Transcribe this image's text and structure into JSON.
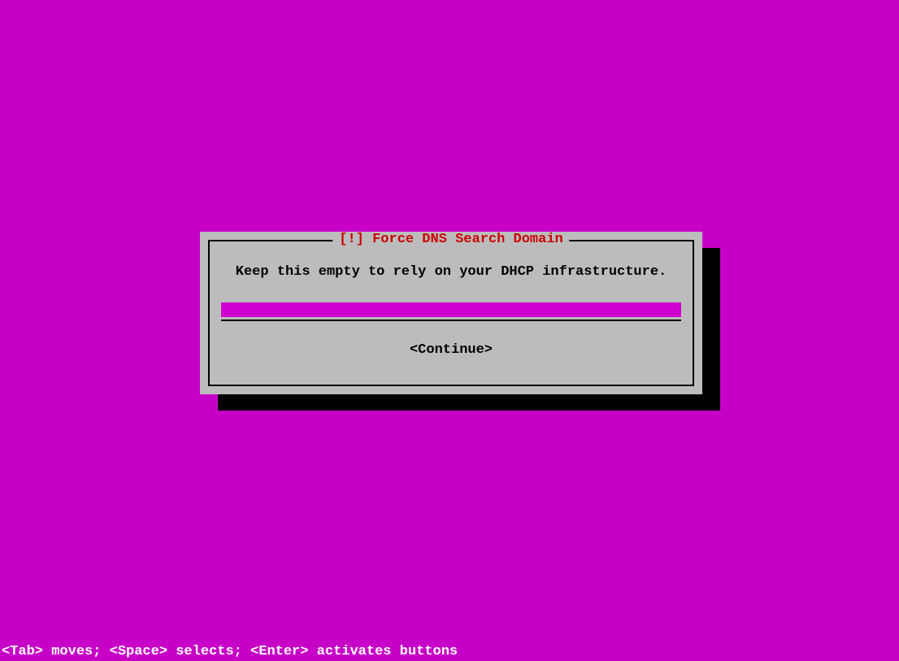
{
  "dialog": {
    "title_prefix": "[!] ",
    "title": "Force DNS Search Domain",
    "instruction": "Keep this empty to rely on your DHCP infrastructure.",
    "input_value": "",
    "continue_label": "<Continue>"
  },
  "footer": {
    "help_text": "<Tab> moves; <Space> selects; <Enter> activates buttons"
  }
}
